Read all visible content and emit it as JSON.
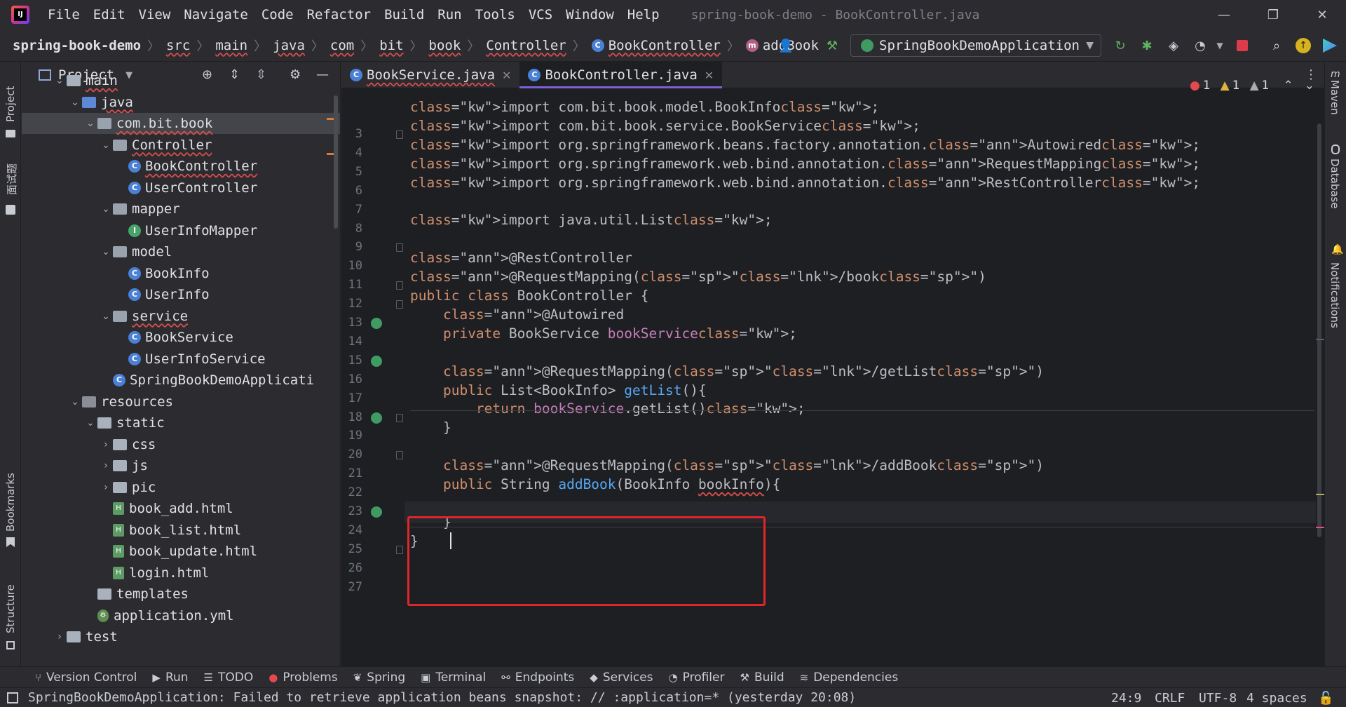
{
  "menu": [
    "File",
    "Edit",
    "View",
    "Navigate",
    "Code",
    "Refactor",
    "Build",
    "Run",
    "Tools",
    "VCS",
    "Window",
    "Help"
  ],
  "window_title": "spring-book-demo - BookController.java",
  "window_controls": {
    "minimize": "—",
    "restore": "❐",
    "close": "✕"
  },
  "breadcrumbs": [
    "spring-book-demo",
    "src",
    "main",
    "java",
    "com",
    "bit",
    "book",
    "Controller",
    "BookController",
    "addBook"
  ],
  "run_config": "SpringBookDemoApplication",
  "left_stripe": {
    "project": "Project",
    "bookmarks": "Bookmarks",
    "structure": "Structure",
    "cn": "面试题"
  },
  "right_stripe": {
    "maven": "Maven",
    "database": "Database",
    "notifications": "Notifications"
  },
  "project_panel": {
    "title": "Project",
    "tree": [
      {
        "label": "main",
        "depth": 3,
        "expanded": true,
        "type": "folder"
      },
      {
        "label": "java",
        "depth": 4,
        "expanded": true,
        "type": "src"
      },
      {
        "label": "com.bit.book",
        "depth": 5,
        "expanded": true,
        "type": "package",
        "selected": true
      },
      {
        "label": "Controller",
        "depth": 6,
        "expanded": true,
        "type": "package"
      },
      {
        "label": "BookController",
        "depth": 7,
        "type": "class"
      },
      {
        "label": "UserController",
        "depth": 7,
        "type": "class"
      },
      {
        "label": "mapper",
        "depth": 6,
        "expanded": true,
        "type": "package"
      },
      {
        "label": "UserInfoMapper",
        "depth": 7,
        "type": "interface"
      },
      {
        "label": "model",
        "depth": 6,
        "expanded": true,
        "type": "package"
      },
      {
        "label": "BookInfo",
        "depth": 7,
        "type": "class"
      },
      {
        "label": "UserInfo",
        "depth": 7,
        "type": "class"
      },
      {
        "label": "service",
        "depth": 6,
        "expanded": true,
        "type": "package"
      },
      {
        "label": "BookService",
        "depth": 7,
        "type": "class"
      },
      {
        "label": "UserInfoService",
        "depth": 7,
        "type": "class"
      },
      {
        "label": "SpringBookDemoApplicati",
        "depth": 6,
        "type": "spring"
      },
      {
        "label": "resources",
        "depth": 4,
        "expanded": true,
        "type": "res"
      },
      {
        "label": "static",
        "depth": 5,
        "expanded": true,
        "type": "folder"
      },
      {
        "label": "css",
        "depth": 6,
        "expanded": false,
        "type": "folder"
      },
      {
        "label": "js",
        "depth": 6,
        "expanded": false,
        "type": "folder"
      },
      {
        "label": "pic",
        "depth": 6,
        "expanded": false,
        "type": "folder"
      },
      {
        "label": "book_add.html",
        "depth": 6,
        "type": "html"
      },
      {
        "label": "book_list.html",
        "depth": 6,
        "type": "html"
      },
      {
        "label": "book_update.html",
        "depth": 6,
        "type": "html"
      },
      {
        "label": "login.html",
        "depth": 6,
        "type": "html"
      },
      {
        "label": "templates",
        "depth": 5,
        "type": "folder"
      },
      {
        "label": "application.yml",
        "depth": 5,
        "type": "yml"
      },
      {
        "label": "test",
        "depth": 3,
        "expanded": false,
        "type": "folder"
      }
    ]
  },
  "tabs": [
    {
      "label": "BookService.java",
      "active": false
    },
    {
      "label": "BookController.java",
      "active": true
    }
  ],
  "inspections": {
    "errors": "1",
    "warnings": "1",
    "weak": "1"
  },
  "code_lines": [
    {
      "n": "3",
      "text": "import com.bit.book.model.BookInfo;"
    },
    {
      "n": "4",
      "text": "import com.bit.book.service.BookService;"
    },
    {
      "n": "5",
      "text": "import org.springframework.beans.factory.annotation.Autowired;"
    },
    {
      "n": "6",
      "text": "import org.springframework.web.bind.annotation.RequestMapping;"
    },
    {
      "n": "7",
      "text": "import org.springframework.web.bind.annotation.RestController;"
    },
    {
      "n": "8",
      "text": ""
    },
    {
      "n": "9",
      "text": "import java.util.List;"
    },
    {
      "n": "10",
      "text": ""
    },
    {
      "n": "11",
      "text": "@RestController"
    },
    {
      "n": "12",
      "text": "@RequestMapping(\"/book\")"
    },
    {
      "n": "13",
      "text": "public class BookController {"
    },
    {
      "n": "14",
      "text": "    @Autowired"
    },
    {
      "n": "15",
      "text": "    private BookService bookService;"
    },
    {
      "n": "16",
      "text": ""
    },
    {
      "n": "17",
      "text": "    @RequestMapping(\"/getList\")"
    },
    {
      "n": "18",
      "text": "    public List<BookInfo> getList(){"
    },
    {
      "n": "19",
      "text": "        return bookService.getList();"
    },
    {
      "n": "20",
      "text": "    }"
    },
    {
      "n": "21",
      "text": ""
    },
    {
      "n": "22",
      "text": "    @RequestMapping(\"/addBook\")"
    },
    {
      "n": "23",
      "text": "    public String addBook(BookInfo bookInfo){"
    },
    {
      "n": "24",
      "text": ""
    },
    {
      "n": "25",
      "text": "    }"
    },
    {
      "n": "26",
      "text": "}"
    },
    {
      "n": "27",
      "text": ""
    }
  ],
  "tool_windows": [
    "Version Control",
    "Run",
    "TODO",
    "Problems",
    "Spring",
    "Terminal",
    "Endpoints",
    "Services",
    "Profiler",
    "Build",
    "Dependencies"
  ],
  "status": {
    "message": "SpringBookDemoApplication: Failed to retrieve application beans snapshot: // :application=* (yesterday 20:08)",
    "position": "24:9",
    "line_sep": "CRLF",
    "encoding": "UTF-8",
    "indent": "4 spaces"
  },
  "colors": {
    "accent": "#7b61d6",
    "highlight_box": "#e2252a",
    "keyword": "#cf8e6d",
    "annotation": "#b3ae60",
    "string": "#6aab73",
    "field": "#c77dbb",
    "method": "#56a8f5"
  }
}
